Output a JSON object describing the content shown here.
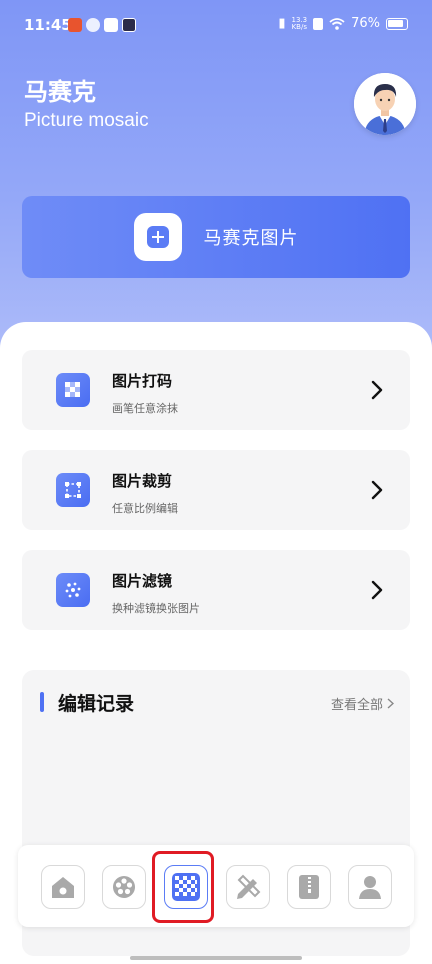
{
  "status_bar": {
    "time": "11:45",
    "net_speed_value": "13.3",
    "net_speed_unit": "KB/s",
    "battery": "76%"
  },
  "header": {
    "title": "马赛克",
    "subtitle": "Picture mosaic"
  },
  "banner": {
    "label": "马赛克图片"
  },
  "tools": [
    {
      "title": "图片打码",
      "subtitle": "画笔任意涂抹",
      "icon": "mosaic-grid-icon"
    },
    {
      "title": "图片裁剪",
      "subtitle": "任意比例编辑",
      "icon": "crop-icon"
    },
    {
      "title": "图片滤镜",
      "subtitle": "换种滤镜换张图片",
      "icon": "filter-icon"
    }
  ],
  "records": {
    "title": "编辑记录",
    "view_all": "查看全部"
  },
  "bottom_nav": {
    "items": [
      {
        "icon": "home-icon",
        "active": false
      },
      {
        "icon": "film-reel-icon",
        "active": false
      },
      {
        "icon": "mosaic-icon",
        "active": true
      },
      {
        "icon": "pencil-ruler-icon",
        "active": false
      },
      {
        "icon": "zip-file-icon",
        "active": false
      },
      {
        "icon": "profile-icon",
        "active": false
      }
    ]
  },
  "colors": {
    "accent": "#4f71f3",
    "hero_top": "#7f96f6",
    "highlight": "#e01b24"
  }
}
